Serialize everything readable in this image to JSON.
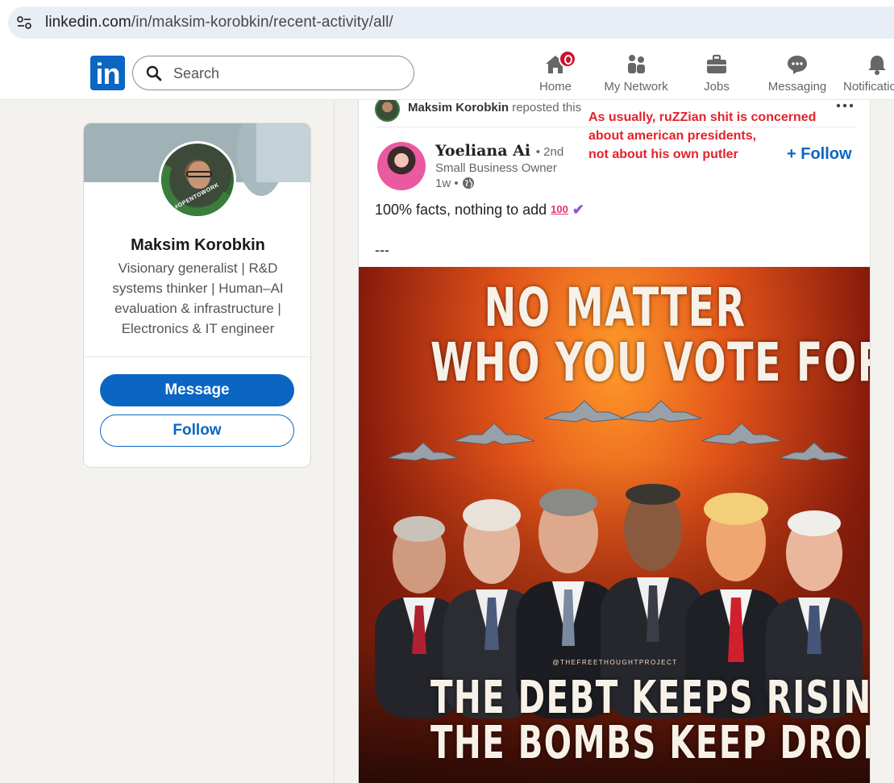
{
  "browser": {
    "url_host": "linkedin.com",
    "url_path": "/in/maksim-korobkin/recent-activity/all/"
  },
  "nav": {
    "logo": "in",
    "search_placeholder": "Search",
    "items": [
      {
        "label": "Home",
        "icon": "home-icon"
      },
      {
        "label": "My Network",
        "icon": "people-icon"
      },
      {
        "label": "Jobs",
        "icon": "briefcase-icon"
      },
      {
        "label": "Messaging",
        "icon": "chat-icon"
      },
      {
        "label": "Notifications",
        "icon": "bell-icon"
      }
    ]
  },
  "profile": {
    "name": "Maksim Korobkin",
    "headline": "Visionary generalist | R&D systems thinker | Human–AI evaluation & infrastructure | Electronics & IT engineer",
    "message_label": "Message",
    "follow_label": "Follow",
    "avatar_badge": "#OPENTOWORK"
  },
  "post": {
    "reposter": "Maksim Korobkin",
    "repost_suffix": "reposted this",
    "annotation_lines": [
      "As usually, ruZZian shit is concerned",
      "about american presidents,",
      "not about his own putler"
    ],
    "author_name": "Yoeliana Ai",
    "author_degree": "• 2nd",
    "author_title": "Small Business Owner",
    "author_time": "1w •",
    "follow_label": "+ Follow",
    "text": "100% facts, nothing to add",
    "emoji_100": "100",
    "checkmark": "✔",
    "separator": "---",
    "image": {
      "headline_1": "NO MATTER",
      "headline_2": "WHO YOU VOTE FOR",
      "watermark": "@THEFREETHOUGHTPROJECT",
      "bottom_1": "THE DEBT KEEPS RISING AND",
      "bottom_2": "THE BOMBS KEEP DROPPING"
    }
  },
  "colors": {
    "linkedin_blue": "#0a66c2",
    "annotation_red": "#e2222a",
    "notification_red": "#cb112d",
    "background": "#f4f2ee"
  }
}
